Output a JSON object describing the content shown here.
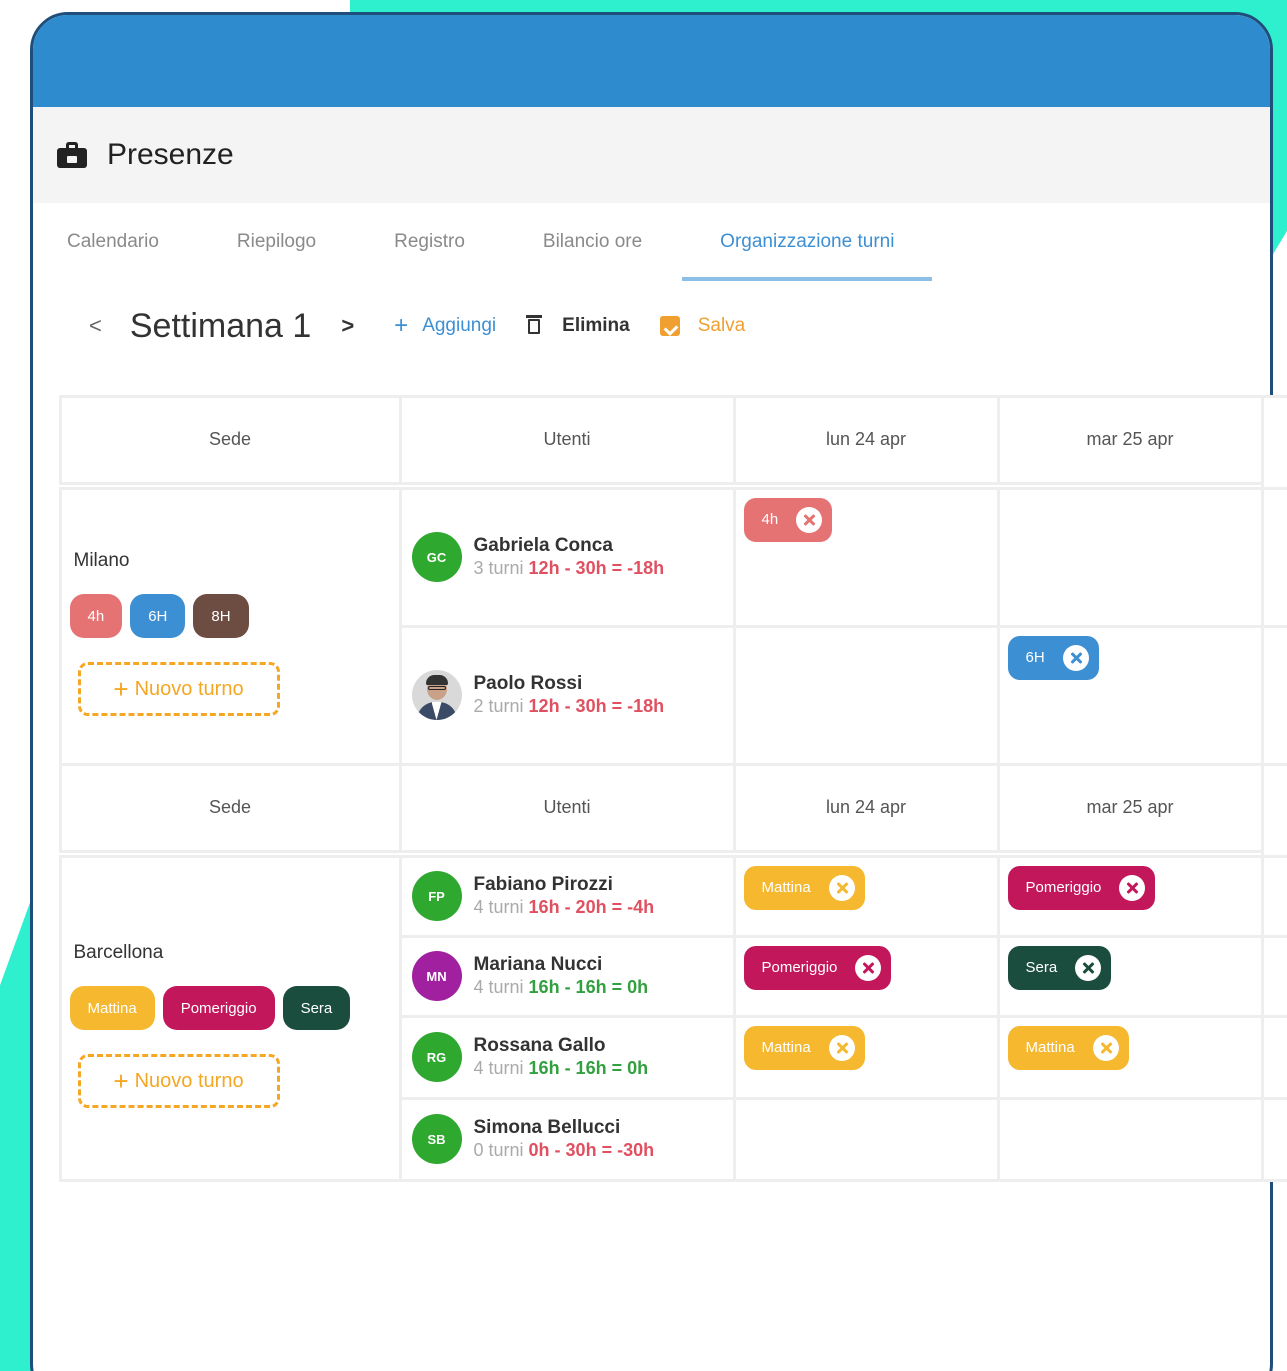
{
  "app": {
    "title": "Presenze",
    "icon": "briefcase-icon"
  },
  "tabs": [
    {
      "label": "Calendario",
      "active": false
    },
    {
      "label": "Riepilogo",
      "active": false
    },
    {
      "label": "Registro",
      "active": false
    },
    {
      "label": "Bilancio ore",
      "active": false
    },
    {
      "label": "Organizzazione turni",
      "active": true
    }
  ],
  "toolbar": {
    "prev": "<",
    "week_title": "Settimana 1",
    "next": ">",
    "add_plus": "+",
    "add_label": "Aggiungi",
    "delete_label": "Elimina",
    "save_label": "Salva"
  },
  "colors": {
    "header_blue": "#2e8bcd",
    "accent_orange": "#f5a623",
    "link_blue": "#3d8fd3",
    "negative": "#e05060",
    "positive": "#33a040"
  },
  "sections": [
    {
      "headers": {
        "sede": "Sede",
        "utenti": "Utenti",
        "day1": "lun 24 apr",
        "day2": "mar 25 apr"
      },
      "sede": {
        "name": "Milano",
        "chips": [
          {
            "label": "4h",
            "color": "#e57373"
          },
          {
            "label": "6H",
            "color": "#3d8fd3"
          },
          {
            "label": "8H",
            "color": "#6d4c41"
          }
        ],
        "new_plus": "+",
        "new_label": "Nuovo turno"
      },
      "rows": [
        {
          "name": "Gabriela Conca",
          "initials": "GC",
          "avatar_color": "#2fa82f",
          "count": "3 turni",
          "hours": "12h - 30h = -18h",
          "tone": "red",
          "day1": {
            "label": "4h",
            "color": "#e57373"
          },
          "day2": null
        },
        {
          "name": "Paolo Rossi",
          "initials": "",
          "avatar_color": "photo",
          "count": "2 turni",
          "hours": "12h - 30h = -18h",
          "tone": "red",
          "day1": null,
          "day2": {
            "label": "6H",
            "color": "#3d8fd3"
          }
        }
      ]
    },
    {
      "headers": {
        "sede": "Sede",
        "utenti": "Utenti",
        "day1": "lun 24 apr",
        "day2": "mar 25 apr"
      },
      "sede": {
        "name": "Barcellona",
        "chips": [
          {
            "label": "Mattina",
            "color": "#f5b82e"
          },
          {
            "label": "Pomeriggio",
            "color": "#c2185b"
          },
          {
            "label": "Sera",
            "color": "#1b4d3e"
          }
        ],
        "new_plus": "+",
        "new_label": "Nuovo turno"
      },
      "rows": [
        {
          "name": "Fabiano Pirozzi",
          "initials": "FP",
          "avatar_color": "#2fa82f",
          "count": "4 turni",
          "hours": "16h - 20h = -4h",
          "tone": "red",
          "day1": {
            "label": "Mattina",
            "color": "#f5b82e"
          },
          "day2": {
            "label": "Pomeriggio",
            "color": "#c2185b"
          }
        },
        {
          "name": "Mariana Nucci",
          "initials": "MN",
          "avatar_color": "#a020a0",
          "count": "4 turni",
          "hours": "16h - 16h = 0h",
          "tone": "green",
          "day1": {
            "label": "Pomeriggio",
            "color": "#c2185b"
          },
          "day2": {
            "label": "Sera",
            "color": "#1b4d3e"
          }
        },
        {
          "name": "Rossana Gallo",
          "initials": "RG",
          "avatar_color": "#2fa82f",
          "count": "4 turni",
          "hours": "16h - 16h = 0h",
          "tone": "green",
          "day1": {
            "label": "Mattina",
            "color": "#f5b82e"
          },
          "day2": {
            "label": "Mattina",
            "color": "#f5b82e"
          }
        },
        {
          "name": "Simona Bellucci",
          "initials": "SB",
          "avatar_color": "#2fa82f",
          "count": "0 turni",
          "hours": "0h - 30h = -30h",
          "tone": "red",
          "day1": null,
          "day2": null
        }
      ]
    }
  ]
}
